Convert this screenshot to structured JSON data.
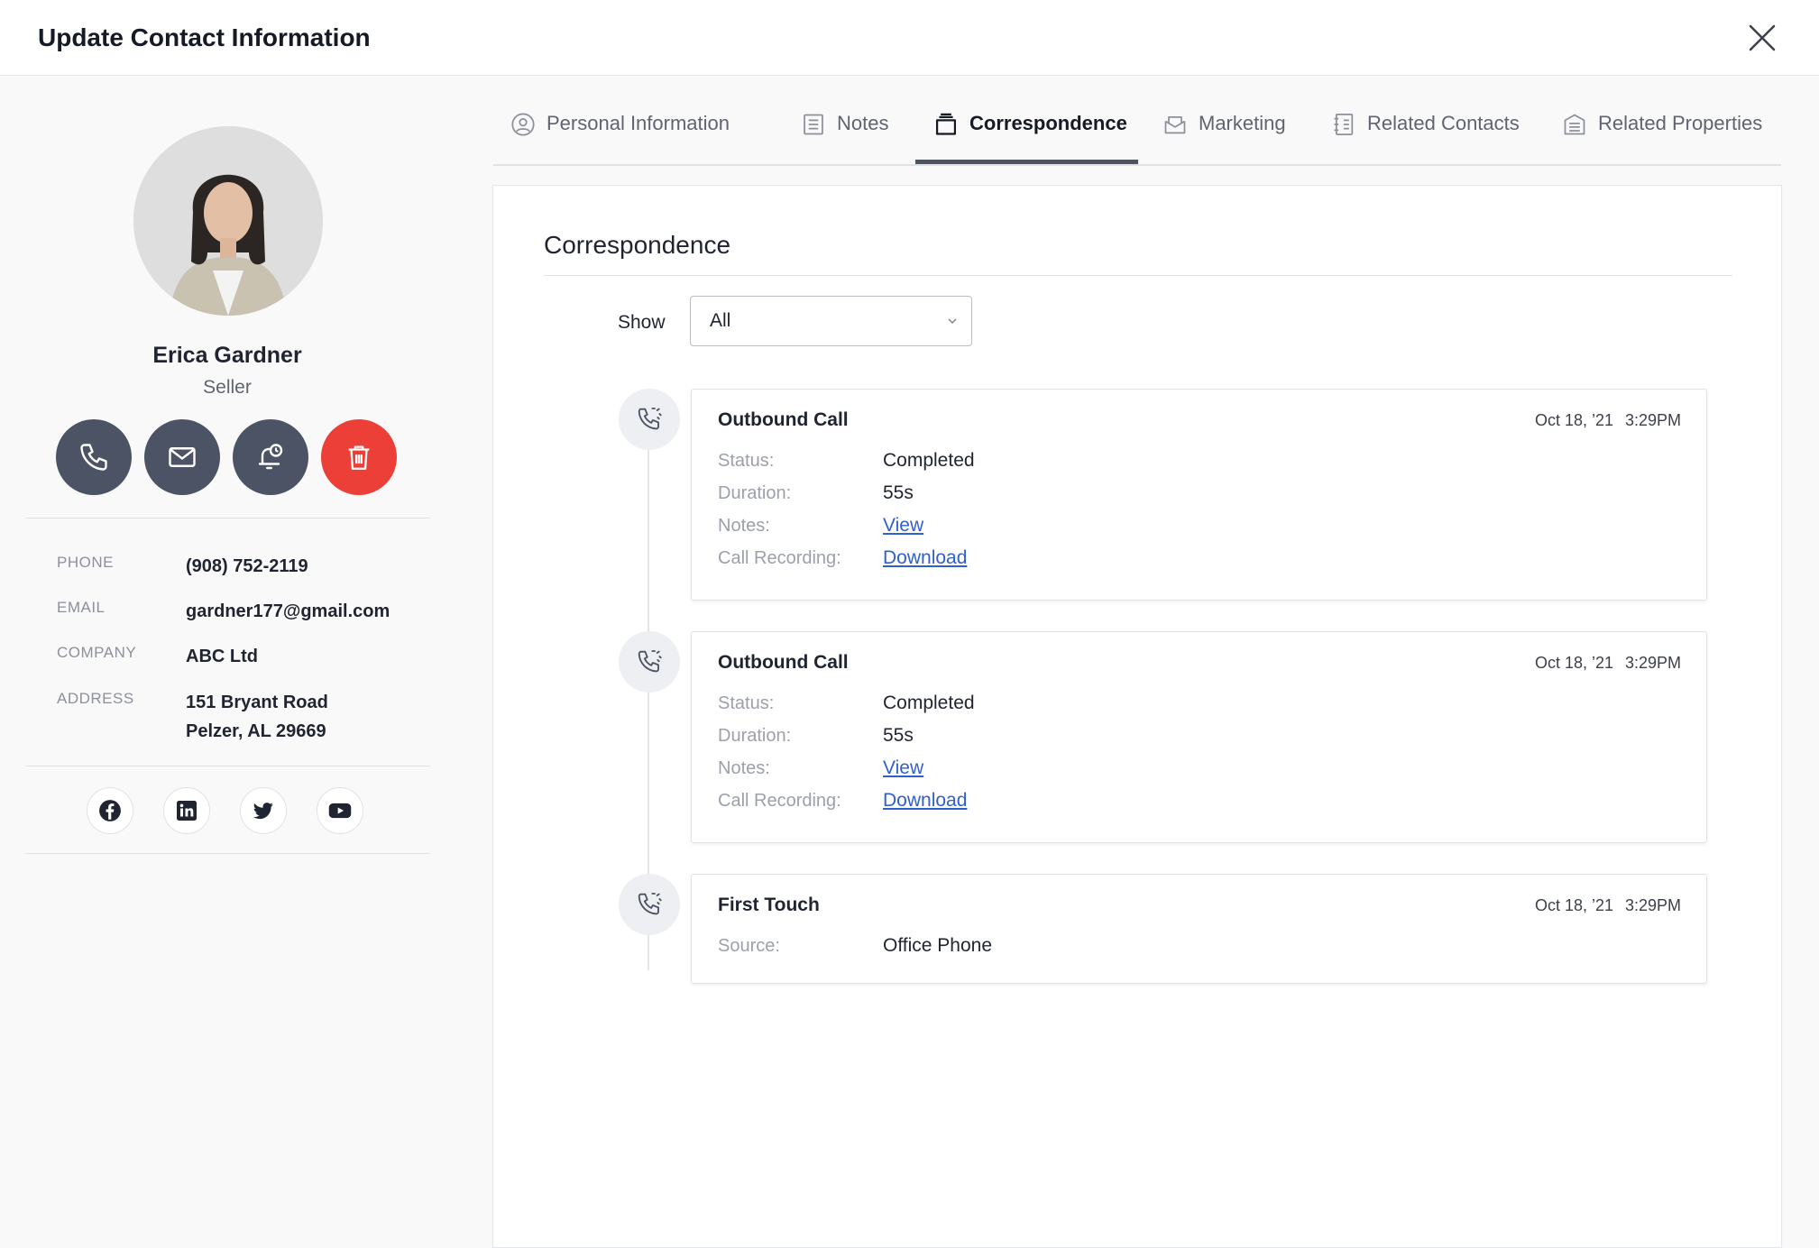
{
  "header": {
    "title": "Update Contact Information"
  },
  "contact": {
    "name": "Erica Gardner",
    "role": "Seller",
    "phone_label": "PHONE",
    "phone": "(908) 752-2119",
    "email_label": "EMAIL",
    "email": "gardner177@gmail.com",
    "company_label": "COMPANY",
    "company": "ABC Ltd",
    "address_label": "ADDRESS",
    "address_line1": "151 Bryant Road",
    "address_line2": "Pelzer, AL 29669"
  },
  "actions": {
    "call_icon": "phone-icon",
    "email_icon": "mail-icon",
    "reminder_icon": "bell-clock-icon",
    "delete_icon": "trash-icon"
  },
  "socials": [
    "facebook-icon",
    "linkedin-icon",
    "twitter-icon",
    "youtube-icon"
  ],
  "tabs": [
    {
      "label": "Personal Information",
      "icon": "user-icon"
    },
    {
      "label": "Notes",
      "icon": "notes-icon"
    },
    {
      "label": "Correspondence",
      "icon": "folder-icon",
      "active": true
    },
    {
      "label": "Marketing",
      "icon": "envelope-open-icon"
    },
    {
      "label": "Related Contacts",
      "icon": "address-book-icon"
    },
    {
      "label": "Related Properties",
      "icon": "building-icon"
    }
  ],
  "main": {
    "title": "Correspondence",
    "show_label": "Show",
    "show_value": "All",
    "entries": [
      {
        "title": "Outbound Call",
        "date": "Oct 18, ’21",
        "time": "3:29PM",
        "status_label": "Status:",
        "status": "Completed",
        "duration_label": "Duration:",
        "duration": "55s",
        "notes_label": "Notes:",
        "notes_link": "View",
        "recording_label": "Call Recording:",
        "recording_link": "Download"
      },
      {
        "title": "Outbound Call",
        "date": "Oct 18, ’21",
        "time": "3:29PM",
        "status_label": "Status:",
        "status": "Completed",
        "duration_label": "Duration:",
        "duration": "55s",
        "notes_label": "Notes:",
        "notes_link": "View",
        "recording_label": "Call Recording:",
        "recording_link": "Download"
      },
      {
        "title": "First Touch",
        "date": "Oct 18, ’21",
        "time": "3:29PM",
        "source_label": "Source:",
        "source": "Office Phone"
      }
    ]
  },
  "colors": {
    "accent_dark": "#4b5365",
    "danger": "#ec3f38",
    "link": "#2f5fd1"
  }
}
